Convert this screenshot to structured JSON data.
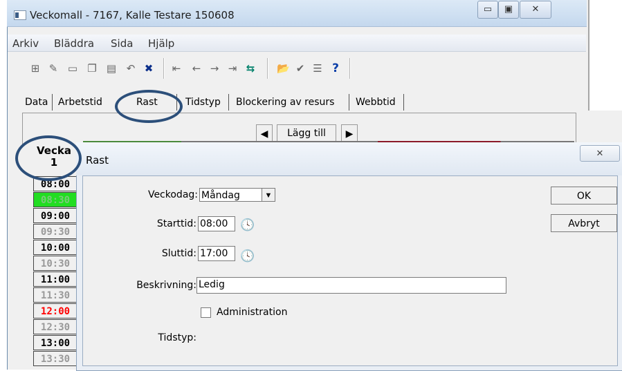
{
  "window": {
    "title": "Veckomall - 7167, Kalle Testare 150608",
    "min_glyph": "▭",
    "max_glyph": "▣",
    "close_glyph": "✕"
  },
  "menu": {
    "items": [
      "Arkiv",
      "Bläddra",
      "Sida",
      "Hjälp"
    ]
  },
  "toolbar": {
    "icons": [
      {
        "name": "new-record-icon",
        "glyph": "⊞"
      },
      {
        "name": "edit-icon",
        "glyph": "✎"
      },
      {
        "name": "table-icon",
        "glyph": "▭"
      },
      {
        "name": "copy-icon",
        "glyph": "❐"
      },
      {
        "name": "save-icon",
        "glyph": "▤"
      },
      {
        "name": "undo-icon",
        "glyph": "↶"
      },
      {
        "name": "delete-icon",
        "glyph": "✖"
      },
      {
        "name": "first-icon",
        "glyph": "⇤"
      },
      {
        "name": "previous-icon",
        "glyph": "←"
      },
      {
        "name": "next-icon",
        "glyph": "→"
      },
      {
        "name": "last-icon",
        "glyph": "⇥"
      },
      {
        "name": "sync-icon",
        "glyph": "⇆"
      },
      {
        "name": "open-folder-icon",
        "glyph": "📂"
      },
      {
        "name": "check-icon",
        "glyph": "✔"
      },
      {
        "name": "list-icon",
        "glyph": "☰"
      },
      {
        "name": "help-icon",
        "glyph": "?"
      }
    ],
    "sync_color": "#00806a",
    "help_color": "#0b3fa8",
    "delete_color": "#0b2f8a"
  },
  "tabs": [
    "Data",
    "Arbetstid",
    "Rast",
    "Tidstyp",
    "Blockering av resurs",
    "Webbtid"
  ],
  "nav": {
    "prev": "◀",
    "add": "Lägg till",
    "next": "▶"
  },
  "week": {
    "header_line1": "Vecka",
    "header_line2": "1",
    "times": [
      {
        "label": "08:00",
        "style": "bold"
      },
      {
        "label": "08:30",
        "style": "green"
      },
      {
        "label": "09:00",
        "style": "bold"
      },
      {
        "label": "09:30",
        "style": "half"
      },
      {
        "label": "10:00",
        "style": "bold"
      },
      {
        "label": "10:30",
        "style": "half"
      },
      {
        "label": "11:00",
        "style": "bold"
      },
      {
        "label": "11:30",
        "style": "half"
      },
      {
        "label": "12:00",
        "style": "red"
      },
      {
        "label": "12:30",
        "style": "half"
      },
      {
        "label": "13:00",
        "style": "bold"
      },
      {
        "label": "13:30",
        "style": "half"
      }
    ]
  },
  "dialog": {
    "title": "Rast",
    "close_glyph": "✕",
    "weekday_label": "Veckodag:",
    "weekday_value": "Måndag",
    "start_label": "Starttid:",
    "start_value": "08:00",
    "end_label": "Sluttid:",
    "end_value": "17:00",
    "description_label": "Beskrivning:",
    "description_value": "Ledig",
    "admin_label": "Administration",
    "admin_checked": false,
    "type_label": "Tidstyp:",
    "ok_label": "OK",
    "cancel_label": "Avbryt",
    "clock_glyph": "🕓",
    "dropdown_glyph": "▼"
  },
  "colors": {
    "highlight_oval": "#2c4f7a",
    "green_slot": "#22dd22",
    "red_time": "#ff0000"
  }
}
